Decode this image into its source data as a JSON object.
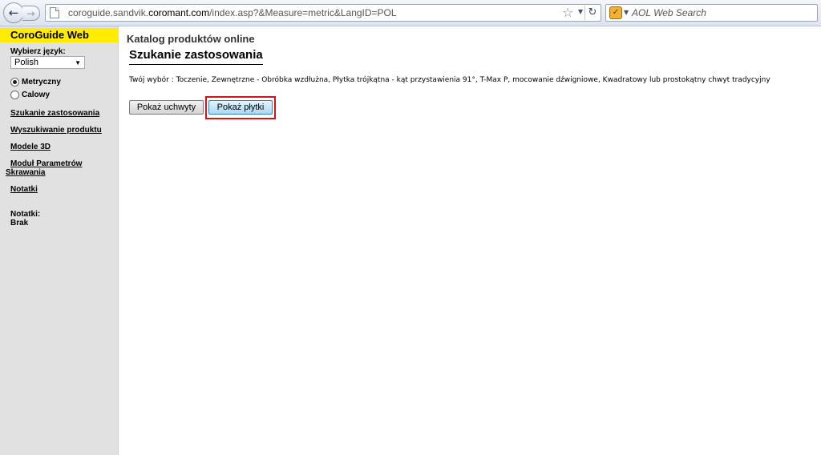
{
  "browser": {
    "url_prefix": "coroguide.sandvik.",
    "url_domain": "coromant.com",
    "url_suffix": "/index.asp?&Measure=metric&LangID=POL",
    "search_placeholder": "AOL Web Search",
    "icons": [
      "back-icon",
      "forward-icon",
      "page-icon",
      "star-icon",
      "reload-icon",
      "search-engine-icon"
    ]
  },
  "sidebar": {
    "brand": "CoroGuide Web",
    "language_label": "Wybierz język:",
    "language_selected": "Polish",
    "measure_options": [
      {
        "label": "Metryczny",
        "selected": true
      },
      {
        "label": "Calowy",
        "selected": false
      }
    ],
    "links": [
      "Szukanie zastosowania",
      "Wyszukiwanie produktu",
      "Modele 3D",
      "Moduł Parametrów Skrawania",
      "Notatki"
    ],
    "notes_label": "Notatki:",
    "notes_value": "Brak"
  },
  "main": {
    "catalog_title": "Katalog produktów online",
    "heading": "Szukanie zastosowania",
    "selection": "Twój wybór : Toczenie, Zewnętrzne - Obróbka wzdłużna, Płytka trójkątna - kąt przystawienia 91°, T-Max P, mocowanie dźwigniowe, Kwadratowy lub prostokątny chwyt tradycyjny",
    "buttons": {
      "show_holders": "Pokaż uchwyty",
      "show_inserts": "Pokaż płytki"
    }
  },
  "colors": {
    "brand_yellow": "#ffec00",
    "sidebar_bg": "#e1e1e1",
    "highlight_red": "#d0141a",
    "active_button": "#a9d9f5"
  }
}
